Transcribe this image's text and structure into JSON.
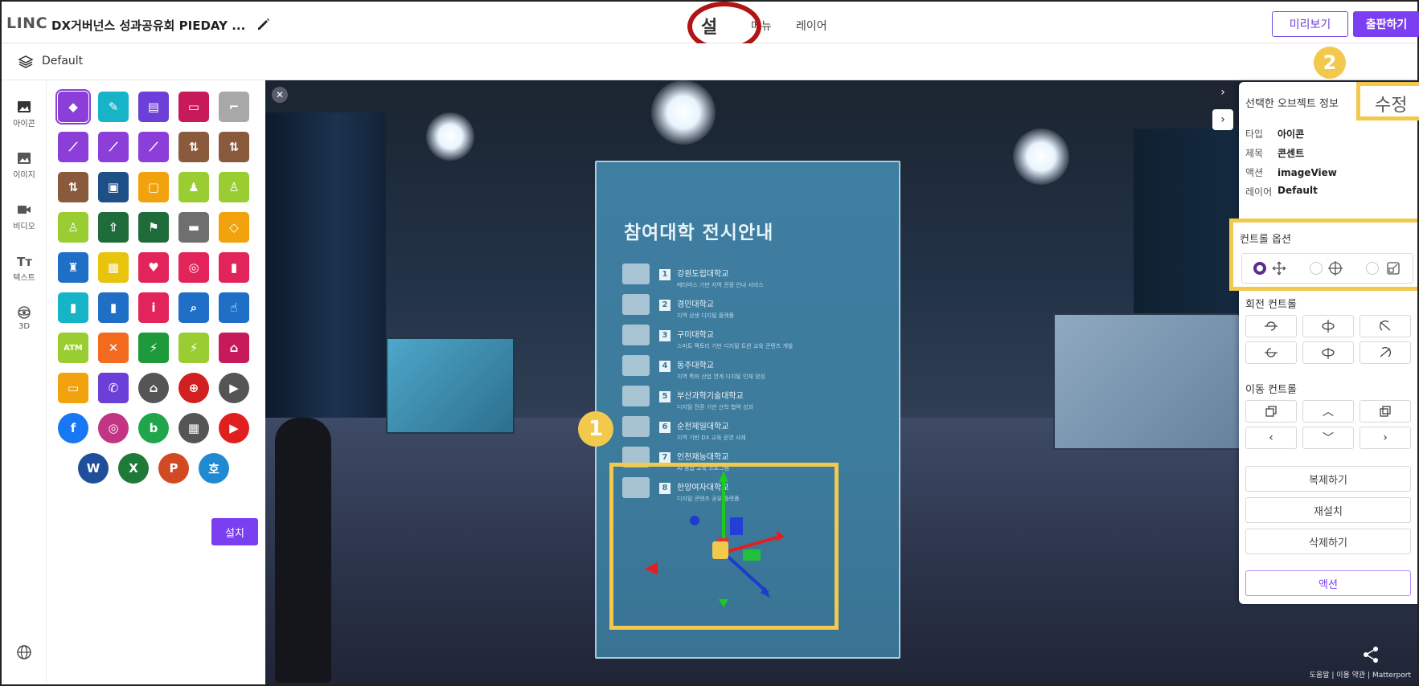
{
  "header": {
    "logo": "LINC",
    "project_title": "DX거버넌스 성과공유회 PIEDAY ...",
    "nav_install": "설치",
    "nav_menu": "메뉴",
    "nav_layer": "레이어",
    "preview_label": "미리보기",
    "publish_label": "출판하기"
  },
  "layerbar": {
    "layer_name": "Default"
  },
  "rail": {
    "items": [
      {
        "label": "아이콘",
        "icon": "image-icon"
      },
      {
        "label": "이미지",
        "icon": "photo-icon"
      },
      {
        "label": "비디오",
        "icon": "video-icon"
      },
      {
        "label": "텍스트",
        "icon": "text-icon"
      },
      {
        "label": "3D",
        "icon": "3d-icon"
      }
    ]
  },
  "icon_panel": {
    "install_label": "설치",
    "tiles": [
      {
        "name": "plug-icon",
        "bg": "#8b3fd8",
        "glyph": "◆"
      },
      {
        "name": "mic-icon",
        "bg": "#17b3c7",
        "glyph": "✎"
      },
      {
        "name": "speaker-icon",
        "bg": "#6c3fd8",
        "glyph": "▤"
      },
      {
        "name": "projector-icon",
        "bg": "#c71a5b",
        "glyph": "▭"
      },
      {
        "name": "stairs-icon",
        "bg": "#a8a8a8",
        "glyph": "⌐"
      },
      {
        "name": "escalator-up-icon",
        "bg": "#8b3fd8",
        "glyph": "⟋"
      },
      {
        "name": "escalator-icon",
        "bg": "#8b3fd8",
        "glyph": "⟋"
      },
      {
        "name": "escalator-down-icon",
        "bg": "#8b3fd8",
        "glyph": "⟋"
      },
      {
        "name": "elevator-icon",
        "bg": "#8a5a3c",
        "glyph": "⇅"
      },
      {
        "name": "elevator-2-icon",
        "bg": "#8a5a3c",
        "glyph": "⇅"
      },
      {
        "name": "elevator-3-icon",
        "bg": "#8a5a3c",
        "glyph": "⇅"
      },
      {
        "name": "freight-elevator-icon",
        "bg": "#1f4f87",
        "glyph": "▣"
      },
      {
        "name": "elevator-box-icon",
        "bg": "#f2a20c",
        "glyph": "▢"
      },
      {
        "name": "restroom-icon",
        "bg": "#9acd32",
        "glyph": "♟"
      },
      {
        "name": "man-icon",
        "bg": "#9acd32",
        "glyph": "♙"
      },
      {
        "name": "woman-icon",
        "bg": "#9acd32",
        "glyph": "♙"
      },
      {
        "name": "exit-icon",
        "bg": "#1f6b3a",
        "glyph": "⇧"
      },
      {
        "name": "emergency-exit-icon",
        "bg": "#1f6b3a",
        "glyph": "⚑"
      },
      {
        "name": "no-smoking-icon",
        "bg": "#6f6f6f",
        "glyph": "▬"
      },
      {
        "name": "vip-icon",
        "bg": "#f2a20c",
        "glyph": "◇"
      },
      {
        "name": "nursing-room-icon",
        "bg": "#1f6fc7",
        "glyph": "♜"
      },
      {
        "name": "caution-tape-icon",
        "bg": "#e8c40c",
        "glyph": "▦"
      },
      {
        "name": "aed-icon",
        "bg": "#e2245a",
        "glyph": "♥"
      },
      {
        "name": "fire-hose-icon",
        "bg": "#e2245a",
        "glyph": "◎"
      },
      {
        "name": "extinguisher-icon",
        "bg": "#e2245a",
        "glyph": "▮"
      },
      {
        "name": "extinguisher-2-icon",
        "bg": "#17b3c7",
        "glyph": "▮"
      },
      {
        "name": "extinguisher-3-icon",
        "bg": "#1f6fc7",
        "glyph": "▮"
      },
      {
        "name": "info-icon",
        "bg": "#e2245a",
        "glyph": "i"
      },
      {
        "name": "search-icon",
        "bg": "#1f6fc7",
        "glyph": "⌕"
      },
      {
        "name": "touch-icon",
        "bg": "#1f6fc7",
        "glyph": "☝"
      },
      {
        "name": "atm-icon",
        "bg": "#9acd32",
        "glyph": "ATM"
      },
      {
        "name": "restaurant-icon",
        "bg": "#f26b1f",
        "glyph": "✕"
      },
      {
        "name": "power-icon",
        "bg": "#1f9a3a",
        "glyph": "⚡"
      },
      {
        "name": "charging-icon",
        "bg": "#9acd32",
        "glyph": "⚡"
      },
      {
        "name": "shop-icon",
        "bg": "#c71a5b",
        "glyph": "⌂"
      },
      {
        "name": "briefcase-icon",
        "bg": "#f2a20c",
        "glyph": "▭"
      },
      {
        "name": "phone-icon",
        "bg": "#6c3fd8",
        "glyph": "✆"
      },
      {
        "name": "home-icon",
        "bg": "#555555",
        "glyph": "⌂",
        "round": true
      },
      {
        "name": "pdf-icon",
        "bg": "#d21f1f",
        "glyph": "⊕",
        "round": true
      },
      {
        "name": "play-icon",
        "bg": "#555555",
        "glyph": "▶",
        "round": true
      },
      {
        "name": "facebook-icon",
        "bg": "#1877f2",
        "glyph": "f",
        "round": true
      },
      {
        "name": "instagram-icon",
        "bg": "#c13584",
        "glyph": "◎",
        "round": true
      },
      {
        "name": "blog-icon",
        "bg": "#1fa64a",
        "glyph": "b",
        "round": true
      },
      {
        "name": "gallery-icon",
        "bg": "#555555",
        "glyph": "▦",
        "round": true
      },
      {
        "name": "youtube-icon",
        "bg": "#e01f1f",
        "glyph": "▶",
        "round": true
      },
      {
        "name": "word-icon",
        "bg": "#1f4f9a",
        "glyph": "W",
        "round": true
      },
      {
        "name": "excel-icon",
        "bg": "#1f7a3a",
        "glyph": "X",
        "round": true
      },
      {
        "name": "powerpoint-icon",
        "bg": "#d14a24",
        "glyph": "P",
        "round": true
      },
      {
        "name": "hwp-icon",
        "bg": "#1f8ad1",
        "glyph": "호",
        "round": true
      }
    ]
  },
  "viewport": {
    "stand_title": "참여대학 전시안내",
    "items": [
      {
        "num": "1",
        "name": "강원도립대학교",
        "sub": "메타버스 기반 지역 관광 안내 서비스"
      },
      {
        "num": "2",
        "name": "경민대학교",
        "sub": "지역 상생 디지털 플랫폼"
      },
      {
        "num": "3",
        "name": "구미대학교",
        "sub": "스마트 팩토리 기반 디지털 트윈 교육 콘텐츠 개발"
      },
      {
        "num": "4",
        "name": "동주대학교",
        "sub": "지역 특화 산업 연계 디지털 인재 양성"
      },
      {
        "num": "5",
        "name": "부산과학기술대학교",
        "sub": "디지털 전환 기반 산학 협력 성과"
      },
      {
        "num": "6",
        "name": "순천제일대학교",
        "sub": "지역 기반 DX 교육 운영 사례"
      },
      {
        "num": "7",
        "name": "인천재능대학교",
        "sub": "AI 융합 교육 프로그램"
      },
      {
        "num": "8",
        "name": "한양여자대학교",
        "sub": "디지털 콘텐츠 공유 플랫폼"
      }
    ],
    "badge_1": "1",
    "badge_2": "2",
    "matterport_text": "도움말 | 이용 약관 | Matterport"
  },
  "object_panel": {
    "header": "선택한 오브젝트 정보",
    "edit_label": "수정",
    "rows": [
      {
        "key": "타입",
        "value": "아이콘"
      },
      {
        "key": "제목",
        "value": "콘센트"
      },
      {
        "key": "액션",
        "value": "imageView"
      },
      {
        "key": "레이어",
        "value": "Default"
      }
    ],
    "control_options_title": "컨트롤 옵션",
    "rotate_title": "회전 컨트롤",
    "move_title": "이동 컨트롤",
    "duplicate_label": "복제하기",
    "reinstall_label": "재설치",
    "delete_label": "삭제하기",
    "action_label": "액션"
  },
  "colors": {
    "accent": "#7b3ff2",
    "highlight": "#f2c94c",
    "annotation_red": "#b01414"
  }
}
